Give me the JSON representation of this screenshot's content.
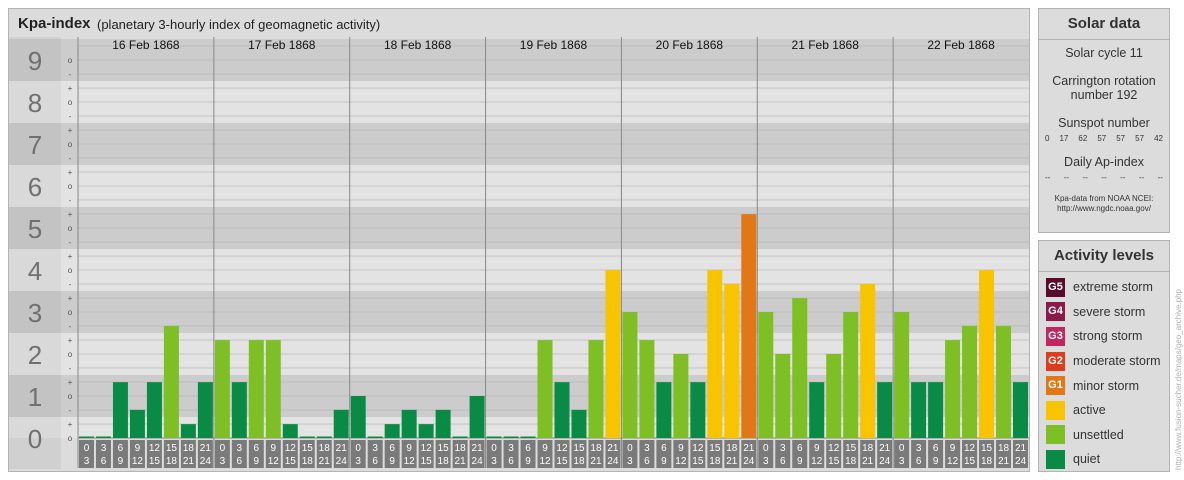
{
  "header": {
    "title": "Kpa-index",
    "subtitle": "(planetary 3-hourly index of geomagnetic activity)"
  },
  "solar": {
    "title": "Solar data",
    "cycle": "Solar cycle 11",
    "carrington_line1": "Carrington rotation",
    "carrington_line2": "number 192",
    "sunspot_title": "Sunspot number",
    "sunspot_values": [
      "0",
      "17",
      "62",
      "57",
      "57",
      "57",
      "42"
    ],
    "ap_title": "Daily Ap-index",
    "ap_values": [
      "--",
      "--",
      "--",
      "--",
      "--",
      "--",
      "--"
    ],
    "source_line1": "Kpa-data from NOAA NCEI:",
    "source_line2": "http://www.ngdc.noaa.gov/"
  },
  "activity": {
    "title": "Activity levels",
    "levels": [
      {
        "code": "G5",
        "label": "extreme storm",
        "color": "#5a0a2a"
      },
      {
        "code": "G4",
        "label": "severe storm",
        "color": "#8b1a4a"
      },
      {
        "code": "G3",
        "label": "strong storm",
        "color": "#c0265f"
      },
      {
        "code": "G2",
        "label": "moderate storm",
        "color": "#dd3c1e"
      },
      {
        "code": "G1",
        "label": "minor storm",
        "color": "#e07818"
      },
      {
        "code": "",
        "label": "active",
        "color": "#f8c400"
      },
      {
        "code": "",
        "label": "unsettled",
        "color": "#7ebf26"
      },
      {
        "code": "",
        "label": "quiet",
        "color": "#0a8b45"
      }
    ]
  },
  "watermark": "http://www.fusion-sucher.de/maps/geo_archive.php",
  "chart_data": {
    "type": "bar",
    "title": "Kpa-index",
    "subtitle": "(planetary 3-hourly index of geomagnetic activity)",
    "ylim": [
      0,
      9
    ],
    "y_ticks": [
      "0",
      "1",
      "2",
      "3",
      "4",
      "5",
      "6",
      "7",
      "8",
      "9"
    ],
    "minor_tick_labels": [
      "o",
      "+",
      "-"
    ],
    "x_intervals_top": [
      "0",
      "3",
      "6",
      "9",
      "12",
      "15",
      "18",
      "21"
    ],
    "x_intervals_bottom": [
      "3",
      "6",
      "9",
      "12",
      "15",
      "18",
      "21",
      "24"
    ],
    "days": [
      {
        "date": "16 Feb 1868",
        "values": [
          0,
          0,
          1.33,
          0.67,
          1.33,
          2.67,
          0.33,
          1.33
        ]
      },
      {
        "date": "17 Feb 1868",
        "values": [
          2.33,
          1.33,
          2.33,
          2.33,
          0.33,
          0,
          0,
          0.67
        ]
      },
      {
        "date": "18 Feb 1868",
        "values": [
          1,
          0,
          0.33,
          0.67,
          0.33,
          0.67,
          0,
          1
        ]
      },
      {
        "date": "19 Feb 1868",
        "values": [
          0,
          0,
          0,
          2.33,
          1.33,
          0.67,
          2.33,
          4
        ]
      },
      {
        "date": "20 Feb 1868",
        "values": [
          3,
          2.33,
          1.33,
          2,
          1.33,
          4,
          3.67,
          5.33
        ]
      },
      {
        "date": "21 Feb 1868",
        "values": [
          3,
          2,
          3.33,
          1.33,
          2,
          3,
          3.67,
          1.33
        ]
      },
      {
        "date": "22 Feb 1868",
        "values": [
          3,
          1.33,
          1.33,
          2.33,
          2.67,
          4,
          2.67,
          1.33
        ]
      }
    ],
    "color_scale": [
      {
        "min_kp": 0,
        "label": "quiet",
        "color": "#0a8b45"
      },
      {
        "min_kp": 2,
        "label": "unsettled",
        "color": "#7ebf26"
      },
      {
        "min_kp": 3.67,
        "label": "active",
        "color": "#f8c400"
      },
      {
        "min_kp": 5,
        "label": "minor storm",
        "color": "#e07818"
      }
    ]
  }
}
